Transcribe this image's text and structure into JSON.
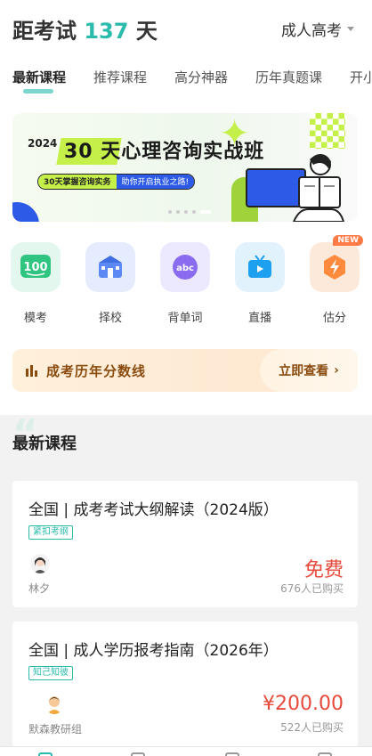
{
  "header": {
    "countdown_prefix": "距考试",
    "countdown_days": "137",
    "countdown_suffix": "天",
    "exam_type": "成人高考"
  },
  "tabs": [
    {
      "label": "最新课程",
      "active": true
    },
    {
      "label": "推荐课程"
    },
    {
      "label": "高分神器"
    },
    {
      "label": "历年真题课"
    },
    {
      "label": "开小"
    }
  ],
  "banner": {
    "year": "2024",
    "title": "30 天心理咨询实战班",
    "pill_left": "30天掌握咨询实务",
    "pill_right": "助你开启执业之路!",
    "slides": 5,
    "active_slide": 4
  },
  "quick_links": [
    {
      "label": "模考",
      "icon": "exam-100-icon"
    },
    {
      "label": "择校",
      "icon": "school-icon"
    },
    {
      "label": "背单词",
      "icon": "abc-icon"
    },
    {
      "label": "直播",
      "icon": "live-tv-icon"
    },
    {
      "label": "估分",
      "icon": "lightning-icon",
      "badge": "NEW"
    }
  ],
  "scoreline": {
    "label": "成考历年分数线",
    "cta": "立即查看"
  },
  "section": {
    "title": "最新课程"
  },
  "courses": [
    {
      "title": "全国 | 成考考试大纲解读（2024版）",
      "tag": "紧扣考纲",
      "teacher": "林夕",
      "price": "免费",
      "buyers": "676人已购买"
    },
    {
      "title": "全国 | 成人学历报考指南（2026年）",
      "tag": "知己知彼",
      "teacher": "默森教研组",
      "price": "¥200.00",
      "buyers": "522人已购买"
    }
  ],
  "colors": {
    "accent": "#2bbbad",
    "price": "#e84a3c",
    "banner_green": "#c5f04a",
    "banner_blue": "#2d5be8"
  }
}
